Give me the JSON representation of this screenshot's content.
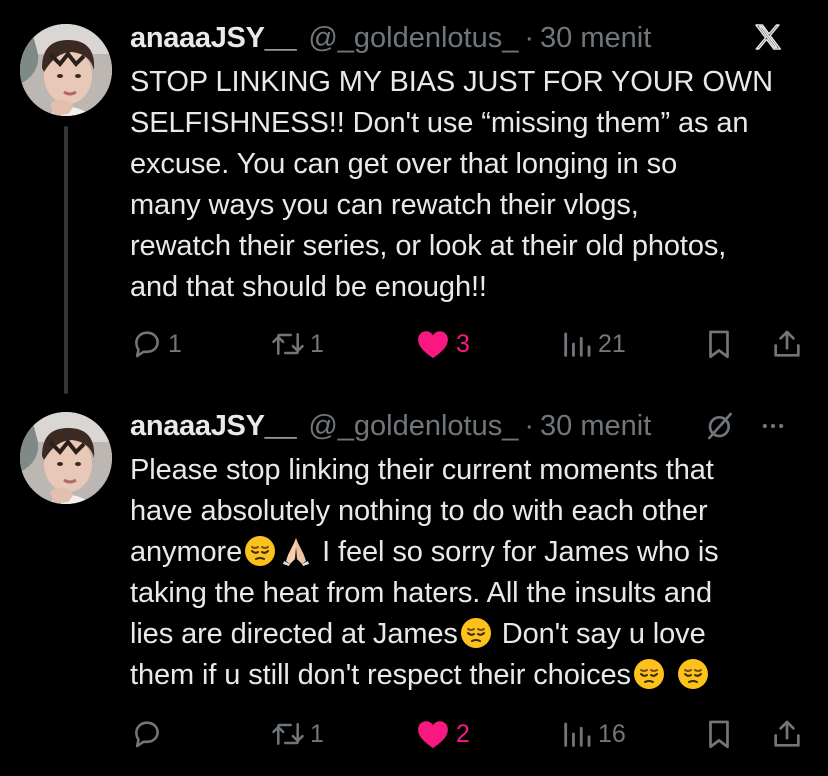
{
  "tweets": [
    {
      "author_name": "anaaaJSY__",
      "handle": "@_goldenlotus_",
      "separator": "·",
      "time": "30 menit",
      "lines": [
        "STOP LINKING MY BIAS JUST FOR YOUR OWN",
        "SELFISHNESS!! Don't use “missing them” as an",
        "excuse. You can get over that longing in so",
        "many ways you can rewatch their vlogs,",
        "rewatch their series, or look at their old photos,",
        "and that should be enough!!"
      ],
      "replies": "1",
      "reposts": "1",
      "likes": "3",
      "views": "21"
    },
    {
      "author_name": "anaaaJSY__",
      "handle": "@_goldenlotus_",
      "separator": "·",
      "time": "30 menit",
      "lines": {
        "l1": "Please stop linking their current moments that",
        "l2": "have absolutely nothing to do with each other",
        "l3a": "anymore",
        "l3b": " I feel so sorry for James who is",
        "l4": "taking the heat from haters. All the insults and",
        "l5a": "lies are directed at James",
        "l5b": " Don't say u love",
        "l6a": "them if u still don't respect their choices"
      },
      "replies": "",
      "reposts": "1",
      "likes": "2",
      "views": "16"
    }
  ],
  "colors": {
    "background": "#000000",
    "text": "#e7e9ea",
    "muted": "#71767b",
    "like": "#f91880",
    "thread_line": "#333639"
  },
  "icons": {
    "brand": "x-logo-icon",
    "reply": "reply-bubble-icon",
    "repost": "repost-icon",
    "like": "heart-filled-icon",
    "views": "views-bar-chart-icon",
    "bookmark": "bookmark-icon",
    "share": "share-upload-icon",
    "grok": "grok-slash-icon",
    "more": "more-dots-icon",
    "emoji_pensive": "pensive-face-emoji",
    "emoji_pray": "folded-hands-emoji"
  }
}
